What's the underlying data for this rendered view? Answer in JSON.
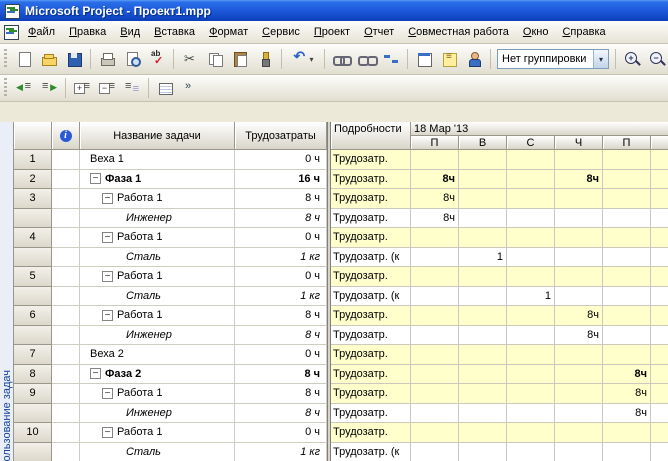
{
  "colors": {
    "titlebar": "#1c56d8",
    "highlight_row": "#ffffcc",
    "toolbar_face": "#ece9d8",
    "grid_line": "#c9c6ba"
  },
  "window": {
    "title": "Microsoft Project - Проект1.mpp"
  },
  "menu": {
    "items": [
      "Файл",
      "Правка",
      "Вид",
      "Вставка",
      "Формат",
      "Сервис",
      "Проект",
      "Отчет",
      "Совместная работа",
      "Окно",
      "Справка"
    ]
  },
  "toolbar_standard": {
    "group_combo": "Нет группировки",
    "icons": [
      "new",
      "open",
      "save",
      "print",
      "print-preview",
      "spelling",
      "cut",
      "copy",
      "paste",
      "format-painter",
      "undo",
      "link-tasks",
      "unlink-tasks",
      "split-task",
      "task-information",
      "task-notes",
      "assign-resources",
      "zoom-in",
      "zoom-out"
    ]
  },
  "toolbar_formatting": {
    "icons": [
      "outdent",
      "indent",
      "show-subtasks",
      "hide-subtasks",
      "hide-assignments",
      "table",
      "toolbar-options"
    ]
  },
  "view_bar": {
    "label": "ользование задач"
  },
  "task_table": {
    "headers": {
      "name": "Название задачи",
      "work": "Трудозатраты"
    },
    "rows": [
      {
        "id": "1",
        "name": "Веха 1",
        "work": "0 ч",
        "level": 0
      },
      {
        "id": "2",
        "name": "Фаза 1",
        "work": "16 ч",
        "level": 0,
        "summary": true,
        "expand": true
      },
      {
        "id": "3",
        "name": "Работа 1",
        "work": "8 ч",
        "level": 1,
        "expand": true
      },
      {
        "id": "",
        "name": "Инженер",
        "work": "8 ч",
        "level": 2,
        "assignment": true
      },
      {
        "id": "4",
        "name": "Работа 1",
        "work": "0 ч",
        "level": 1,
        "expand": true
      },
      {
        "id": "",
        "name": "Сталь",
        "work": "1 кг",
        "level": 2,
        "assignment": true
      },
      {
        "id": "5",
        "name": "Работа 1",
        "work": "0 ч",
        "level": 1,
        "expand": true
      },
      {
        "id": "",
        "name": "Сталь",
        "work": "1 кг",
        "level": 2,
        "assignment": true
      },
      {
        "id": "6",
        "name": "Работа 1",
        "work": "8 ч",
        "level": 1,
        "expand": true
      },
      {
        "id": "",
        "name": "Инженер",
        "work": "8 ч",
        "level": 2,
        "assignment": true
      },
      {
        "id": "7",
        "name": "Веха 2",
        "work": "0 ч",
        "level": 0
      },
      {
        "id": "8",
        "name": "Фаза 2",
        "work": "8 ч",
        "level": 0,
        "summary": true,
        "expand": true
      },
      {
        "id": "9",
        "name": "Работа 1",
        "work": "8 ч",
        "level": 1,
        "expand": true
      },
      {
        "id": "",
        "name": "Инженер",
        "work": "8 ч",
        "level": 2,
        "assignment": true
      },
      {
        "id": "10",
        "name": "Работа 1",
        "work": "0 ч",
        "level": 1,
        "expand": true
      },
      {
        "id": "",
        "name": "Сталь",
        "work": "1 кг",
        "level": 2,
        "assignment": true
      }
    ]
  },
  "timesheet": {
    "details_header": "Подробности",
    "week_label": "18 Мар '13",
    "day_headers": [
      "П",
      "В",
      "С",
      "Ч",
      "П"
    ],
    "rows": [
      {
        "label": "Трудозатр.",
        "cells": [
          "",
          "",
          "",
          "",
          ""
        ],
        "highlight": true
      },
      {
        "label": "Трудозатр.",
        "cells": [
          "8ч",
          "",
          "",
          "8ч",
          ""
        ],
        "highlight": true,
        "bold": true
      },
      {
        "label": "Трудозатр.",
        "cells": [
          "8ч",
          "",
          "",
          "",
          ""
        ],
        "highlight": true
      },
      {
        "label": "Трудозатр.",
        "cells": [
          "8ч",
          "",
          "",
          "",
          ""
        ],
        "highlight": false
      },
      {
        "label": "Трудозатр.",
        "cells": [
          "",
          "",
          "",
          "",
          ""
        ],
        "highlight": true
      },
      {
        "label": "Трудозатр. (к",
        "cells": [
          "",
          "1",
          "",
          "",
          ""
        ],
        "highlight": false
      },
      {
        "label": "Трудозатр.",
        "cells": [
          "",
          "",
          "",
          "",
          ""
        ],
        "highlight": true
      },
      {
        "label": "Трудозатр. (к",
        "cells": [
          "",
          "",
          "1",
          "",
          ""
        ],
        "highlight": false
      },
      {
        "label": "Трудозатр.",
        "cells": [
          "",
          "",
          "",
          "8ч",
          ""
        ],
        "highlight": true
      },
      {
        "label": "Трудозатр.",
        "cells": [
          "",
          "",
          "",
          "8ч",
          ""
        ],
        "highlight": false
      },
      {
        "label": "Трудозатр.",
        "cells": [
          "",
          "",
          "",
          "",
          ""
        ],
        "highlight": true
      },
      {
        "label": "Трудозатр.",
        "cells": [
          "",
          "",
          "",
          "",
          "8ч"
        ],
        "highlight": true,
        "bold": true
      },
      {
        "label": "Трудозатр.",
        "cells": [
          "",
          "",
          "",
          "",
          "8ч"
        ],
        "highlight": true
      },
      {
        "label": "Трудозатр.",
        "cells": [
          "",
          "",
          "",
          "",
          "8ч"
        ],
        "highlight": false
      },
      {
        "label": "Трудозатр.",
        "cells": [
          "",
          "",
          "",
          "",
          ""
        ],
        "highlight": true
      },
      {
        "label": "Трудозатр. (к",
        "cells": [
          "",
          "",
          "",
          "",
          ""
        ],
        "highlight": false
      }
    ]
  }
}
